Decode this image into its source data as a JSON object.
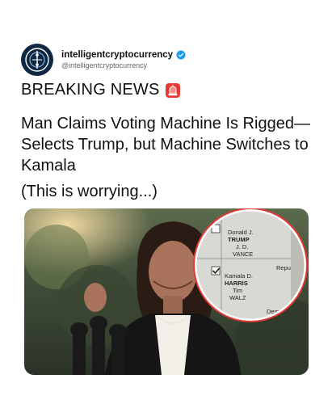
{
  "account": {
    "display_name": "intelligentcryptocurrency",
    "handle": "@intelligentcryptocurrency",
    "avatar_icon": "crypto-coin-logo",
    "verified_icon": "verified-badge-icon"
  },
  "post": {
    "breaking_label": "BREAKING NEWS",
    "siren_icon": "rotating-light-emoji",
    "headline": "Man Claims Voting Machine Is Rigged—Selects Trump, but Machine Switches to Kamala",
    "subtext": "(This is worrying...)"
  },
  "photo": {
    "inset_ballot": {
      "line1": "Donald J.",
      "line2": "TRUMP",
      "line3": "J. D.",
      "line4": "VANCE",
      "party1": "Repub",
      "line5": "Kamala D.",
      "line6": "HARRIS",
      "line7": "Tim",
      "line8": "WALZ",
      "party2": "Dem"
    }
  }
}
